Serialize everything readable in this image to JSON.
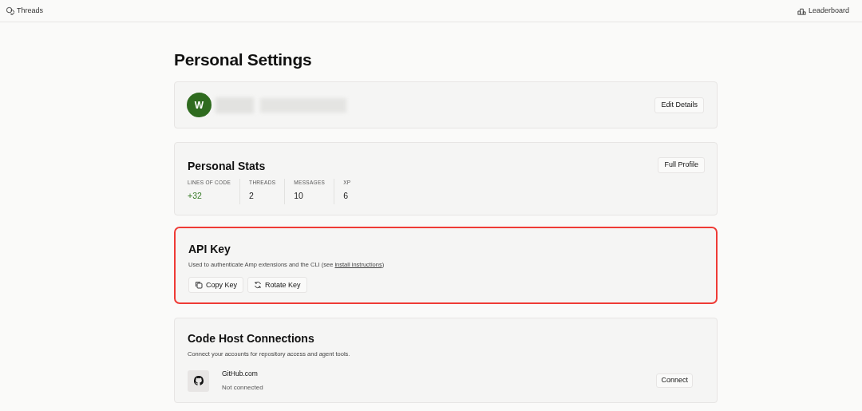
{
  "top_bar": {
    "left_link": "Threads",
    "right_link": "Leaderboard"
  },
  "page_title": "Personal Settings",
  "profile": {
    "avatar_initial": "W",
    "name_redacted": true,
    "button": "Edit Details"
  },
  "stats": {
    "title": "Personal Stats",
    "button": "Full Profile",
    "items": [
      {
        "label": "LINES OF CODE",
        "value": "+32",
        "positive": true
      },
      {
        "label": "THREADS",
        "value": "2",
        "positive": false
      },
      {
        "label": "MESSAGES",
        "value": "10",
        "positive": false
      },
      {
        "label": "XP",
        "value": "6",
        "positive": false
      }
    ]
  },
  "api_key": {
    "title": "API Key",
    "highlighted": true,
    "description": "Used to authenticate Amp extensions and the CLI (see ",
    "link": "install instructions",
    "description_end": ")",
    "buttons": [
      {
        "kind": "copy",
        "label": "Copy Key"
      },
      {
        "kind": "rotate",
        "label": "Rotate Key"
      }
    ]
  },
  "code_hosts": {
    "title": "Code Host Connections",
    "description": "Connect your accounts for repository access and agent tools.",
    "hosts": [
      {
        "name": "GitHub.com",
        "status": "Not connected",
        "button": "Connect"
      }
    ]
  }
}
